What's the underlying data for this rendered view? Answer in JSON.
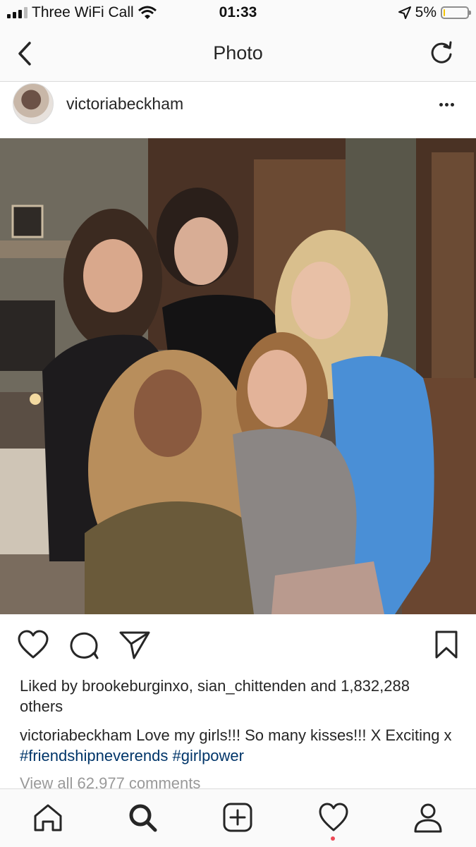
{
  "status_bar": {
    "carrier": "Three WiFi Call",
    "time": "01:33",
    "battery": "5%"
  },
  "nav": {
    "title": "Photo",
    "icons": [
      "back-chevron-icon",
      "refresh-icon"
    ]
  },
  "post": {
    "username": "victoriabeckham",
    "liked_by_prefix": "Liked by",
    "liked_user_1": "brookeburginxo",
    "liked_user_2": "sian_chittenden",
    "liked_and": "and",
    "liked_others": "1,832,288 others",
    "caption_user": "victoriabeckham",
    "caption_text": "Love my girls!!! So many kisses!!! X Exciting x",
    "hashtag_1": "#friendshipneverends",
    "hashtag_2": "#girlpower",
    "view_comments": "View all 62,977 comments"
  },
  "tab_bar": {
    "icons": [
      "home-icon",
      "search-icon",
      "new-post-icon",
      "activity-heart-icon",
      "profile-icon"
    ]
  },
  "colors": {
    "hashtag": "#003569",
    "notification_dot": "#ed4956",
    "battery_fill": "#f5c400"
  }
}
